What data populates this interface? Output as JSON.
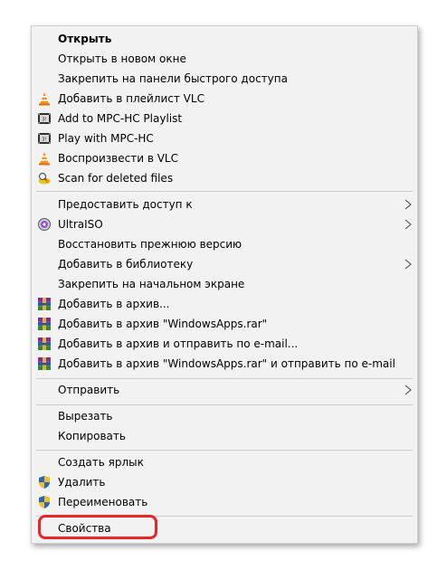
{
  "menu": {
    "items": [
      {
        "label": "Открыть",
        "icon": "none",
        "bold": true
      },
      {
        "label": "Открыть в новом окне",
        "icon": "none"
      },
      {
        "label": "Закрепить на панели быстрого доступа",
        "icon": "none"
      },
      {
        "label": "Добавить в плейлист VLC",
        "icon": "vlc-cone-icon"
      },
      {
        "label": "Add to MPC-HC Playlist",
        "icon": "mpc-hc-icon"
      },
      {
        "label": "Play with MPC-HC",
        "icon": "mpc-hc-icon"
      },
      {
        "label": "Воспроизвести в VLC",
        "icon": "vlc-cone-icon"
      },
      {
        "label": "Scan for deleted files",
        "icon": "recovery-tool-icon"
      },
      {
        "label": "Предоставить доступ к",
        "icon": "none",
        "submenu": true
      },
      {
        "label": "UltraISO",
        "icon": "ultraiso-disc-icon",
        "submenu": true
      },
      {
        "label": "Восстановить прежнюю версию",
        "icon": "none"
      },
      {
        "label": "Добавить в библиотеку",
        "icon": "none",
        "submenu": true
      },
      {
        "label": "Закрепить на начальном экране",
        "icon": "none"
      },
      {
        "label": "Добавить в архив...",
        "icon": "winrar-icon"
      },
      {
        "label": "Добавить в архив \"WindowsApps.rar\"",
        "icon": "winrar-icon"
      },
      {
        "label": "Добавить в архив и отправить по e-mail...",
        "icon": "winrar-icon"
      },
      {
        "label": "Добавить в архив \"WindowsApps.rar\" и отправить по e-mail",
        "icon": "winrar-icon"
      },
      {
        "label": "Отправить",
        "icon": "none",
        "submenu": true
      },
      {
        "label": "Вырезать",
        "icon": "none"
      },
      {
        "label": "Копировать",
        "icon": "none"
      },
      {
        "label": "Создать ярлык",
        "icon": "none"
      },
      {
        "label": "Удалить",
        "icon": "uac-shield-icon"
      },
      {
        "label": "Переименовать",
        "icon": "uac-shield-icon"
      },
      {
        "label": "Свойства",
        "icon": "none",
        "highlighted": true
      }
    ]
  },
  "colors": {
    "menu_background": "#f2f2f2",
    "highlight_ring": "#e8262a"
  }
}
